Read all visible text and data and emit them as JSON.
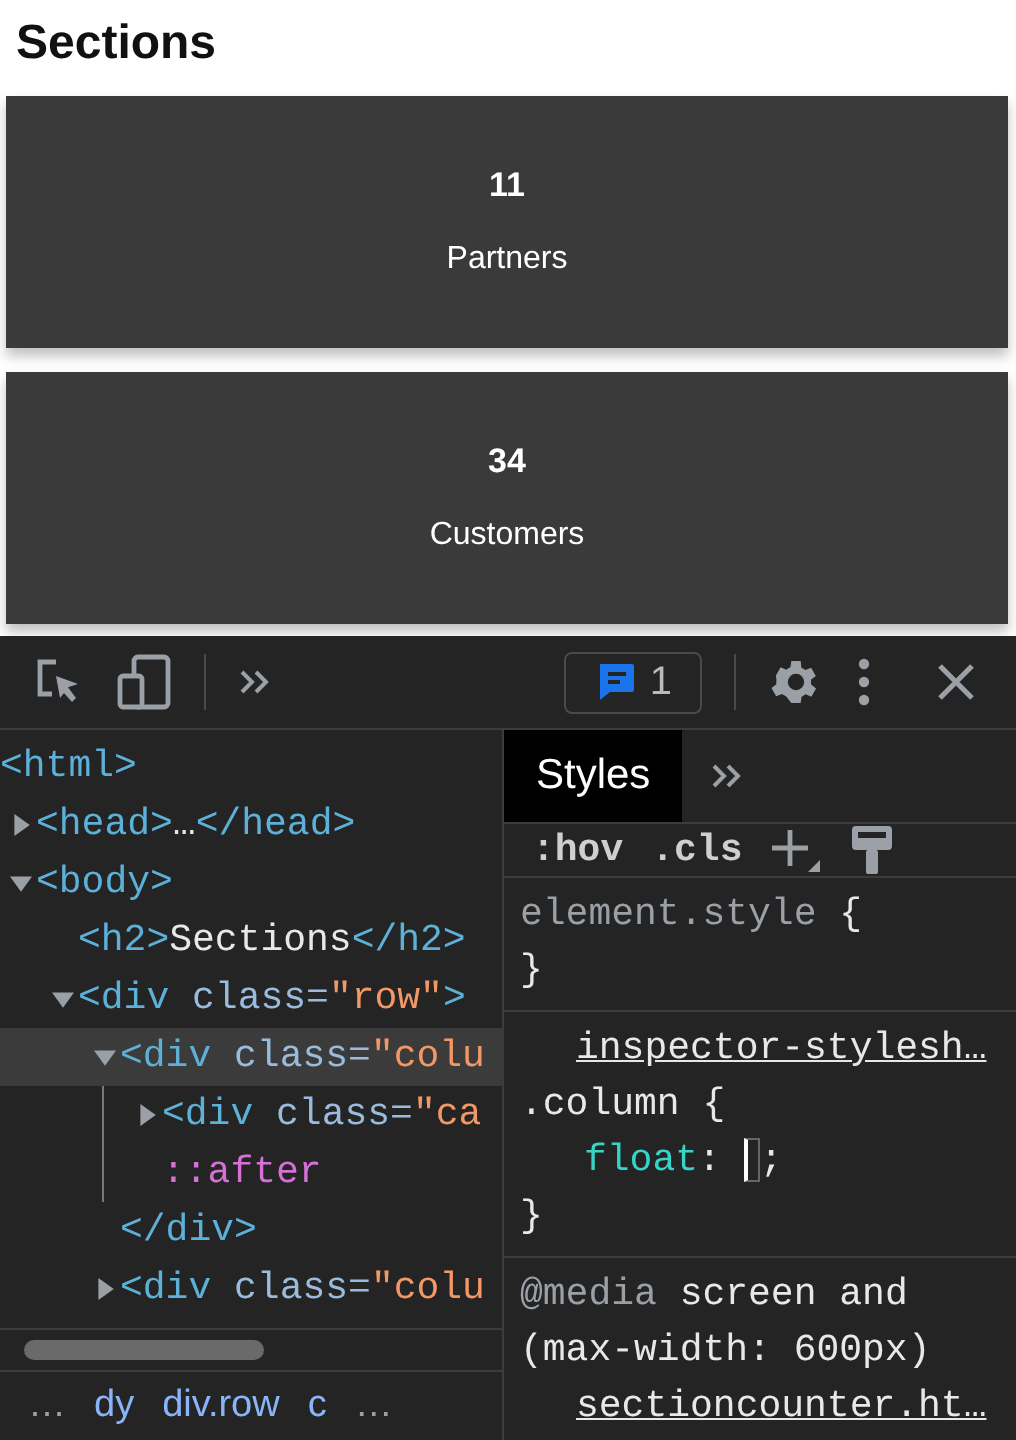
{
  "page": {
    "heading": "Sections",
    "cards": [
      {
        "number": "11",
        "label": "Partners"
      },
      {
        "number": "34",
        "label": "Customers"
      }
    ]
  },
  "devtools": {
    "issues_count": "1",
    "elements": [
      {
        "tokens": [
          {
            "kind": "tag",
            "text": "<html>"
          }
        ],
        "children": [
          {
            "tokens": [
              {
                "kind": "tag",
                "text": "<head>"
              },
              {
                "kind": "text",
                "text": "…"
              },
              {
                "kind": "tag",
                "text": "</head>"
              }
            ],
            "expanded": false,
            "selected": false
          },
          {
            "tokens": [
              {
                "kind": "tag",
                "text": "<body>"
              }
            ],
            "expanded": true,
            "selected": false,
            "children": [
              {
                "tokens": [
                  {
                    "kind": "tag",
                    "text": "<h2>"
                  },
                  {
                    "kind": "text",
                    "text": "Sections"
                  },
                  {
                    "kind": "tag",
                    "text": "</h2>"
                  }
                ],
                "selected": false
              },
              {
                "tokens": [
                  {
                    "kind": "tag",
                    "text": "<div"
                  },
                  {
                    "kind": "attr",
                    "text": " class="
                  },
                  {
                    "kind": "value",
                    "text": "\"row\""
                  },
                  {
                    "kind": "tag",
                    "text": ">"
                  }
                ],
                "expanded": true,
                "selected": false,
                "children": [
                  {
                    "tokens": [
                      {
                        "kind": "tag",
                        "text": "<div"
                      },
                      {
                        "kind": "attr",
                        "text": " class="
                      },
                      {
                        "kind": "value",
                        "text": "\"colu"
                      }
                    ],
                    "expanded": true,
                    "selected": true,
                    "closing": "</div>",
                    "children": [
                      {
                        "tokens": [
                          {
                            "kind": "tag",
                            "text": "<div"
                          },
                          {
                            "kind": "attr",
                            "text": " class="
                          },
                          {
                            "kind": "value",
                            "text": "\"ca"
                          }
                        ],
                        "expanded": false,
                        "selected": false
                      },
                      {
                        "tokens": [
                          {
                            "kind": "pseudo",
                            "text": "::after"
                          }
                        ],
                        "selected": false
                      }
                    ]
                  },
                  {
                    "tokens": [
                      {
                        "kind": "tag",
                        "text": "<div"
                      },
                      {
                        "kind": "attr",
                        "text": " class="
                      },
                      {
                        "kind": "value",
                        "text": "\"colu"
                      }
                    ],
                    "expanded": false,
                    "selected": false
                  }
                ]
              }
            ]
          }
        ]
      }
    ],
    "breadcrumbs": [
      {
        "kind": "more",
        "label": "…"
      },
      {
        "kind": "crumb",
        "label": "dy"
      },
      {
        "kind": "crumb",
        "label": "div.row"
      },
      {
        "kind": "crumb",
        "label": "c"
      },
      {
        "kind": "more",
        "label": "…"
      }
    ],
    "tabs": [
      {
        "label": "Styles",
        "selected": true
      }
    ],
    "style_toolbar": {
      "hov": ":hov",
      "cls": ".cls"
    },
    "style_sections": [
      {
        "lines": [
          {
            "kind": "selector",
            "tokens": [
              {
                "kind": "dim",
                "text": "element.style"
              },
              {
                "kind": "punct",
                "text": " {"
              }
            ]
          },
          {
            "kind": "selector",
            "tokens": [
              {
                "kind": "punct",
                "text": "}"
              }
            ]
          }
        ]
      },
      {
        "lines": [
          {
            "kind": "source",
            "tokens": [
              {
                "kind": "link",
                "text": "inspector-stylesh…"
              }
            ]
          },
          {
            "kind": "selector",
            "tokens": [
              {
                "kind": "punct",
                "text": ".column {"
              }
            ]
          },
          {
            "kind": "declaration",
            "tokens": [
              {
                "kind": "property",
                "text": "float"
              },
              {
                "kind": "punct",
                "text": ": "
              },
              {
                "kind": "caret"
              },
              {
                "kind": "punct",
                "text": ";"
              }
            ]
          },
          {
            "kind": "selector",
            "tokens": [
              {
                "kind": "punct",
                "text": "}"
              }
            ]
          }
        ]
      },
      {
        "lines": [
          {
            "kind": "selector",
            "tokens": [
              {
                "kind": "dim",
                "text": "@media"
              },
              {
                "kind": "punct",
                "text": " screen and"
              }
            ]
          },
          {
            "kind": "selector",
            "tokens": [
              {
                "kind": "punct",
                "text": "(max-width: 600px)"
              }
            ]
          },
          {
            "kind": "source",
            "tokens": [
              {
                "kind": "link",
                "text": "sectioncounter.ht…"
              }
            ]
          }
        ]
      }
    ]
  }
}
